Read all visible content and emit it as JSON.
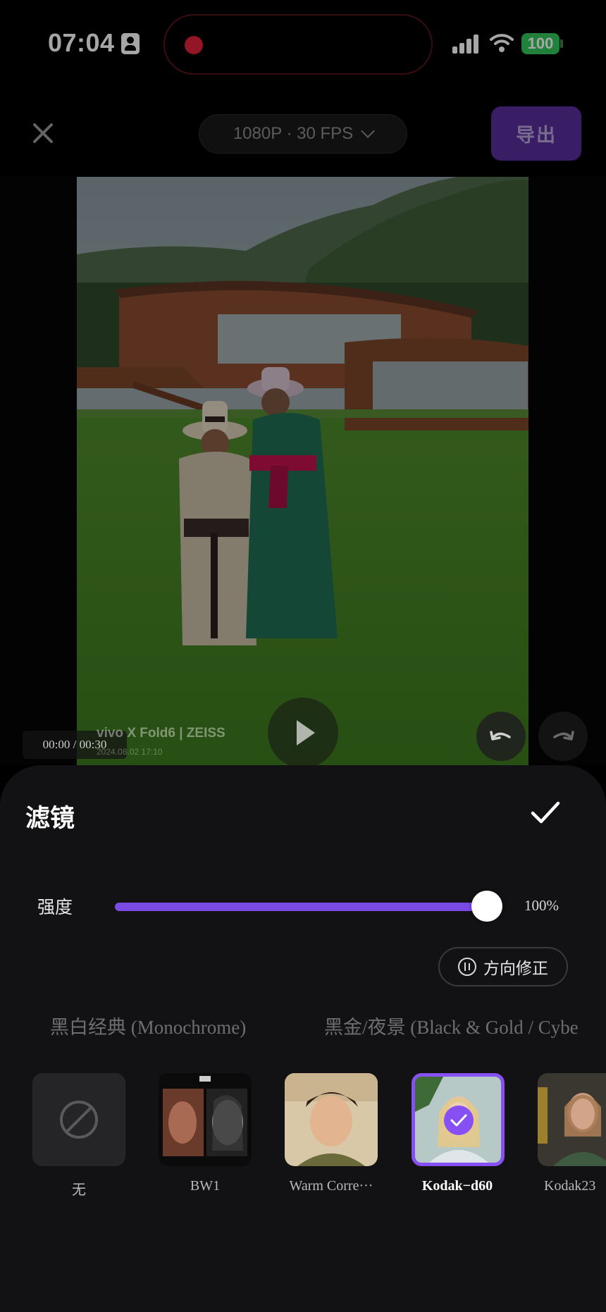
{
  "status": {
    "time": "07:04",
    "battery": "100"
  },
  "toolbar": {
    "resolution": "1080P · 30 FPS",
    "export_label": "导出"
  },
  "preview": {
    "timecode": "00:00 / 00:30",
    "watermark_brand": "vivo",
    "watermark_text": "X Fold6 | ZEISS",
    "watermark_date": "2024.08.02 17:10"
  },
  "panel": {
    "title": "滤镜",
    "intensity_label": "强度",
    "intensity_percent": "100%",
    "intensity_value": 1.0,
    "orientation_label": "方向修正",
    "categories": [
      "黑白经典 (Monochrome)",
      "黑金/夜景 (Black & Gold / Cybe"
    ],
    "filters": [
      {
        "label": "无",
        "icon": "none-icon"
      },
      {
        "label": "BW1"
      },
      {
        "label": "Warm Corre···"
      },
      {
        "label": "Kodak−d60",
        "selected": true
      },
      {
        "label": "Kodak23"
      }
    ]
  },
  "colors": {
    "accent": "#7a4ae6",
    "panel_bg": "#121214",
    "export_bg": "#5a2f9b"
  }
}
